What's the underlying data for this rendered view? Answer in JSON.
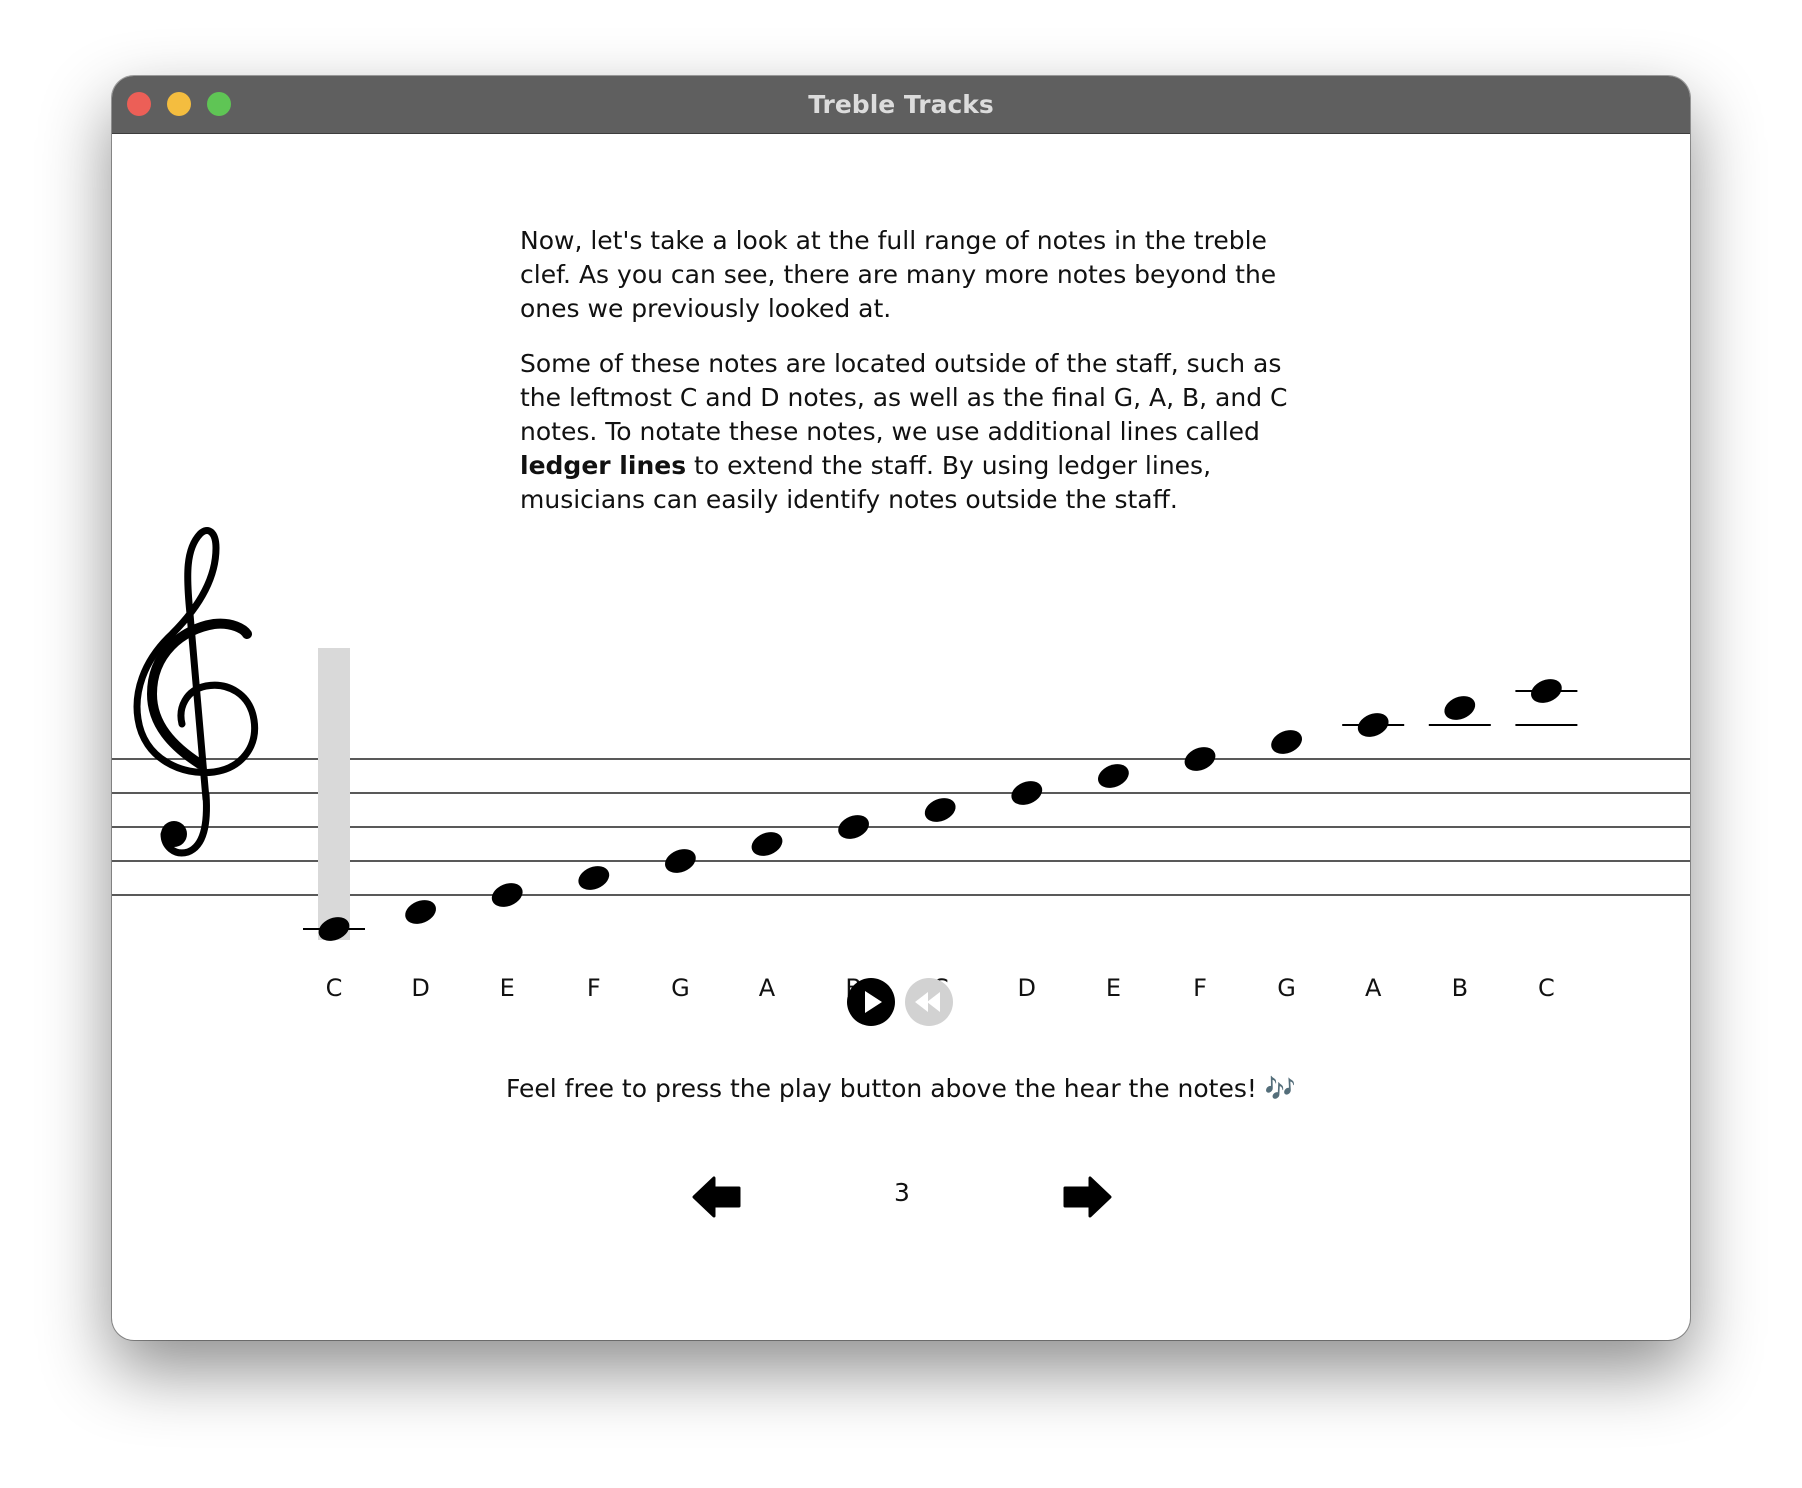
{
  "window": {
    "title": "Treble Tracks"
  },
  "intro": {
    "paragraph1": "Now, let's take a look at the full range of notes in the treble clef. As you can see, there are many more notes beyond the ones we previously looked at.",
    "paragraph2_before": "Some of these notes are located outside of the staff, such as the leftmost C and D notes, as well as the final G, A, B, and C notes. To notate these notes, we use additional lines called ",
    "paragraph2_bold": "ledger lines",
    "paragraph2_after": " to extend the staff. By using ledger lines, musicians can easily identify notes outside the staff."
  },
  "staff": {
    "clef": "treble-clef-icon",
    "highlighted_index": 0,
    "notes": [
      {
        "name": "C",
        "step": -2
      },
      {
        "name": "D",
        "step": -1
      },
      {
        "name": "E",
        "step": 0
      },
      {
        "name": "F",
        "step": 1
      },
      {
        "name": "G",
        "step": 2
      },
      {
        "name": "A",
        "step": 3
      },
      {
        "name": "B",
        "step": 4
      },
      {
        "name": "C",
        "step": 5
      },
      {
        "name": "D",
        "step": 6
      },
      {
        "name": "E",
        "step": 7
      },
      {
        "name": "F",
        "step": 8
      },
      {
        "name": "G",
        "step": 9
      },
      {
        "name": "A",
        "step": 10
      },
      {
        "name": "B",
        "step": 11
      },
      {
        "name": "C",
        "step": 12
      }
    ]
  },
  "controls": {
    "play": "play-icon",
    "rewind": "rewind-icon"
  },
  "hint": {
    "text": "Feel free to press the play button above the hear the notes! 🎶"
  },
  "pagination": {
    "page": "3",
    "prev": "arrow-left-icon",
    "next": "arrow-right-icon"
  },
  "colors": {
    "titlebar": "#5f5f5f",
    "highlight": "#d9d9d9",
    "ink": "#000000",
    "rewind_disabled": "#d2d2d2"
  }
}
